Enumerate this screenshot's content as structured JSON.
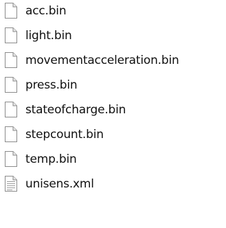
{
  "files": [
    {
      "name": "acc.bin",
      "icon": "file-icon"
    },
    {
      "name": "light.bin",
      "icon": "file-icon"
    },
    {
      "name": "movementacceleration.bin",
      "icon": "file-icon"
    },
    {
      "name": "press.bin",
      "icon": "file-icon"
    },
    {
      "name": "stateofcharge.bin",
      "icon": "file-icon"
    },
    {
      "name": "stepcount.bin",
      "icon": "file-icon"
    },
    {
      "name": "temp.bin",
      "icon": "file-icon"
    },
    {
      "name": "unisens.xml",
      "icon": "text-file-icon"
    }
  ],
  "colors": {
    "text": "#111111",
    "icon_stroke": "#8a8a8a",
    "icon_fill": "#ffffff",
    "fold_fill": "#e8e8e8",
    "text_lines": "#9a9a9a"
  }
}
